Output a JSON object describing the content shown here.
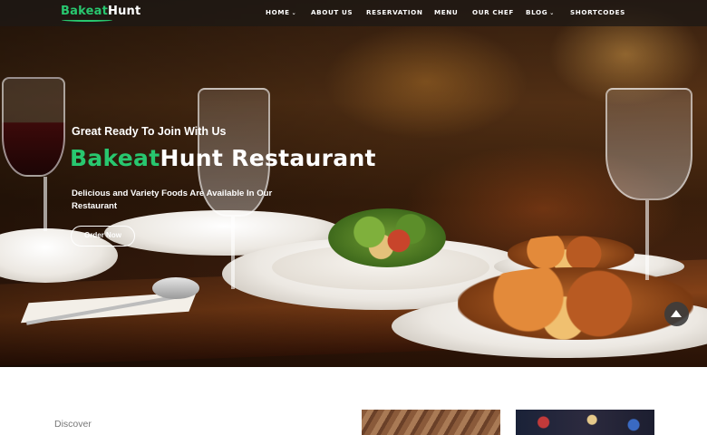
{
  "nav": {
    "logo_part1": "Bakeat",
    "logo_part2": "Hunt",
    "items": [
      {
        "label": "HOME",
        "dropdown": true
      },
      {
        "label": "ABOUT US",
        "dropdown": false
      },
      {
        "label": "RESERVATION",
        "dropdown": false
      },
      {
        "label": "MENU",
        "dropdown": false
      },
      {
        "label": "OUR CHEF",
        "dropdown": false
      },
      {
        "label": "BLOG",
        "dropdown": true
      },
      {
        "label": "SHORTCODES",
        "dropdown": false
      }
    ],
    "dropdown_glyph": "⌄"
  },
  "hero": {
    "tagline": "Great Ready To Join With Us",
    "title_part1": "Bakeat",
    "title_part2": "Hunt Restaurant",
    "description": "Delicious and Variety Foods Are Available In Our Restaurant",
    "order_button": "Order Now"
  },
  "scroll_top_icon": "chevron-up-icon",
  "section": {
    "discover_label": "Discover"
  },
  "colors": {
    "accent": "#28c76f",
    "navbar_bg": "#1e1814"
  }
}
